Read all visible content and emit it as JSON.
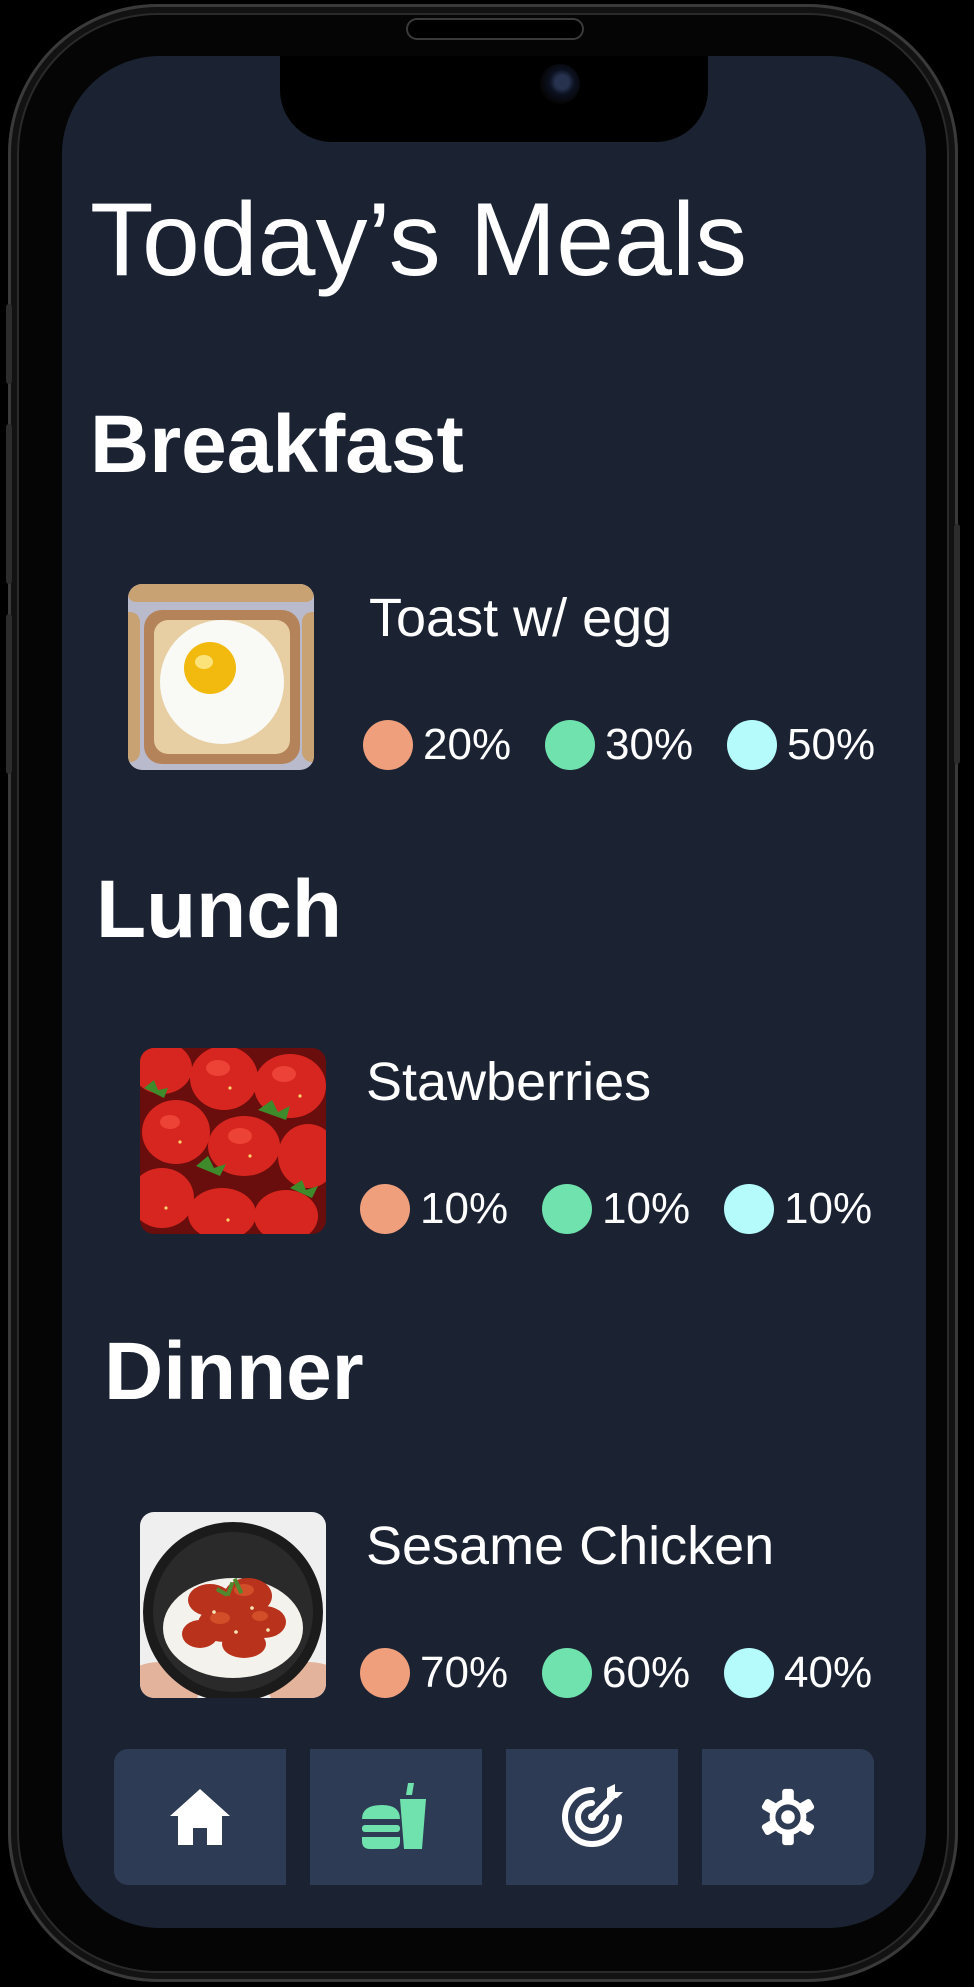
{
  "page": {
    "title": "Today’s Meals"
  },
  "colors": {
    "background": "#1b2333",
    "nav_button": "#2e3b54",
    "macro_1": "#ef9f7b",
    "macro_2": "#6fe2ad",
    "macro_3": "#b5fbfb",
    "active_nav": "#6fe2ad"
  },
  "meals": [
    {
      "section": "Breakfast",
      "name": "Toast w/ egg",
      "image": "toast-with-fried-egg",
      "macros": [
        "20%",
        "30%",
        "50%"
      ]
    },
    {
      "section": "Lunch",
      "name": "Stawberries",
      "image": "strawberries",
      "macros": [
        "10%",
        "10%",
        "10%"
      ]
    },
    {
      "section": "Dinner",
      "name": "Sesame Chicken",
      "image": "sesame-chicken-bowl",
      "macros": [
        "70%",
        "60%",
        "40%"
      ]
    }
  ],
  "nav": [
    {
      "icon": "home-icon",
      "active": false
    },
    {
      "icon": "meals-icon",
      "active": true
    },
    {
      "icon": "goals-target-icon",
      "active": false
    },
    {
      "icon": "settings-gear-icon",
      "active": false
    }
  ]
}
